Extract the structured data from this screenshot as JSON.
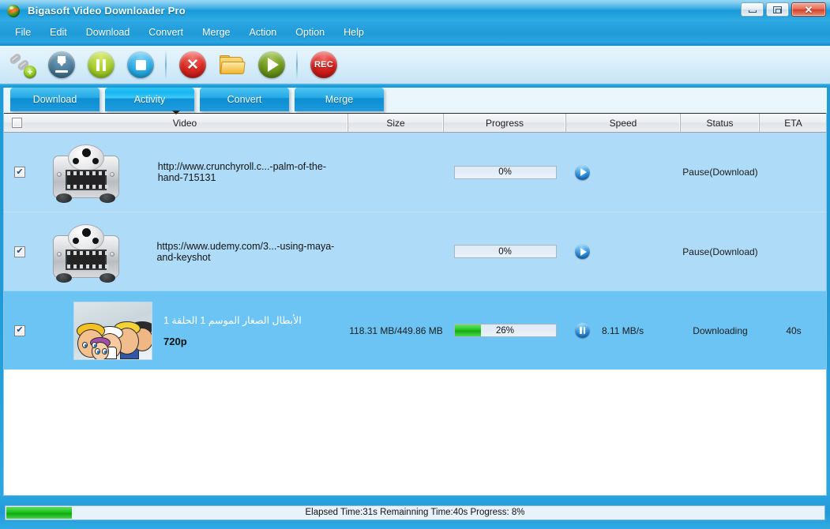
{
  "window": {
    "title": "Bigasoft Video Downloader Pro",
    "icon": "app-logo-icon",
    "controls": {
      "minimize": "minimize-icon",
      "restore": "restore-icon",
      "close": "✕"
    }
  },
  "menu": {
    "items": [
      {
        "label": "File"
      },
      {
        "label": "Edit"
      },
      {
        "label": "Download"
      },
      {
        "label": "Convert"
      },
      {
        "label": "Merge"
      },
      {
        "label": "Action"
      },
      {
        "label": "Option"
      },
      {
        "label": "Help"
      }
    ]
  },
  "toolbar": {
    "buttons": [
      {
        "name": "add-url-button",
        "icon": "link-plus-icon",
        "label": ""
      },
      {
        "name": "start-download-button",
        "icon": "download-arrow-icon",
        "label": ""
      },
      {
        "name": "pause-button",
        "icon": "pause-icon",
        "label": ""
      },
      {
        "name": "stop-button",
        "icon": "stop-icon",
        "label": ""
      },
      {
        "name": "remove-button",
        "icon": "cancel-x-icon",
        "label": ""
      },
      {
        "name": "open-folder-button",
        "icon": "folder-icon",
        "label": ""
      },
      {
        "name": "play-button",
        "icon": "play-icon",
        "label": ""
      },
      {
        "name": "record-button",
        "icon": "rec-icon",
        "label": "REC"
      }
    ],
    "rec_label": "REC"
  },
  "tabs": [
    {
      "label": "Download",
      "active": false
    },
    {
      "label": "Activity",
      "active": true
    },
    {
      "label": "Convert",
      "active": false
    },
    {
      "label": "Merge",
      "active": false
    }
  ],
  "table": {
    "columns": [
      "Video",
      "Size",
      "Progress",
      "Speed",
      "Status",
      "ETA"
    ],
    "header_checkbox_checked": false,
    "rows": [
      {
        "checked": true,
        "thumb": "film-reel-icon",
        "title": "http://www.crunchyroll.c...-palm-of-the-hand-715131",
        "quality": "",
        "size": "",
        "progress_pct": 0,
        "progress_label": "0%",
        "control_icon": "resume-play-icon",
        "speed": "",
        "status": "Pause(Download)",
        "eta": ""
      },
      {
        "checked": true,
        "thumb": "film-reel-icon",
        "title": "https://www.udemy.com/3...-using-maya-and-keyshot",
        "quality": "",
        "size": "",
        "progress_pct": 0,
        "progress_label": "0%",
        "control_icon": "resume-play-icon",
        "speed": "",
        "status": "Pause(Download)",
        "eta": ""
      },
      {
        "checked": true,
        "thumb": "cartoon-thumbnail",
        "title": "الأبطال الصغار الموسم 1 الحلقة 1",
        "quality": "720p",
        "size": "118.31 MB/449.86 MB",
        "progress_pct": 26,
        "progress_label": "26%",
        "control_icon": "pause-icon",
        "speed": "8.11 MB/s",
        "status": "Downloading",
        "eta": "40s"
      }
    ]
  },
  "statusbar": {
    "text": "Elapsed Time:31s Remainning Time:40s Progress: 8%",
    "progress_pct": 8
  },
  "colors": {
    "title_blue": "#1f9bd8",
    "tab_blue": "#1e9ade",
    "row_light": "#aedbf8",
    "row_selected": "#6cc4f5",
    "progress_green": "#22c522",
    "close_red": "#cf4228"
  }
}
